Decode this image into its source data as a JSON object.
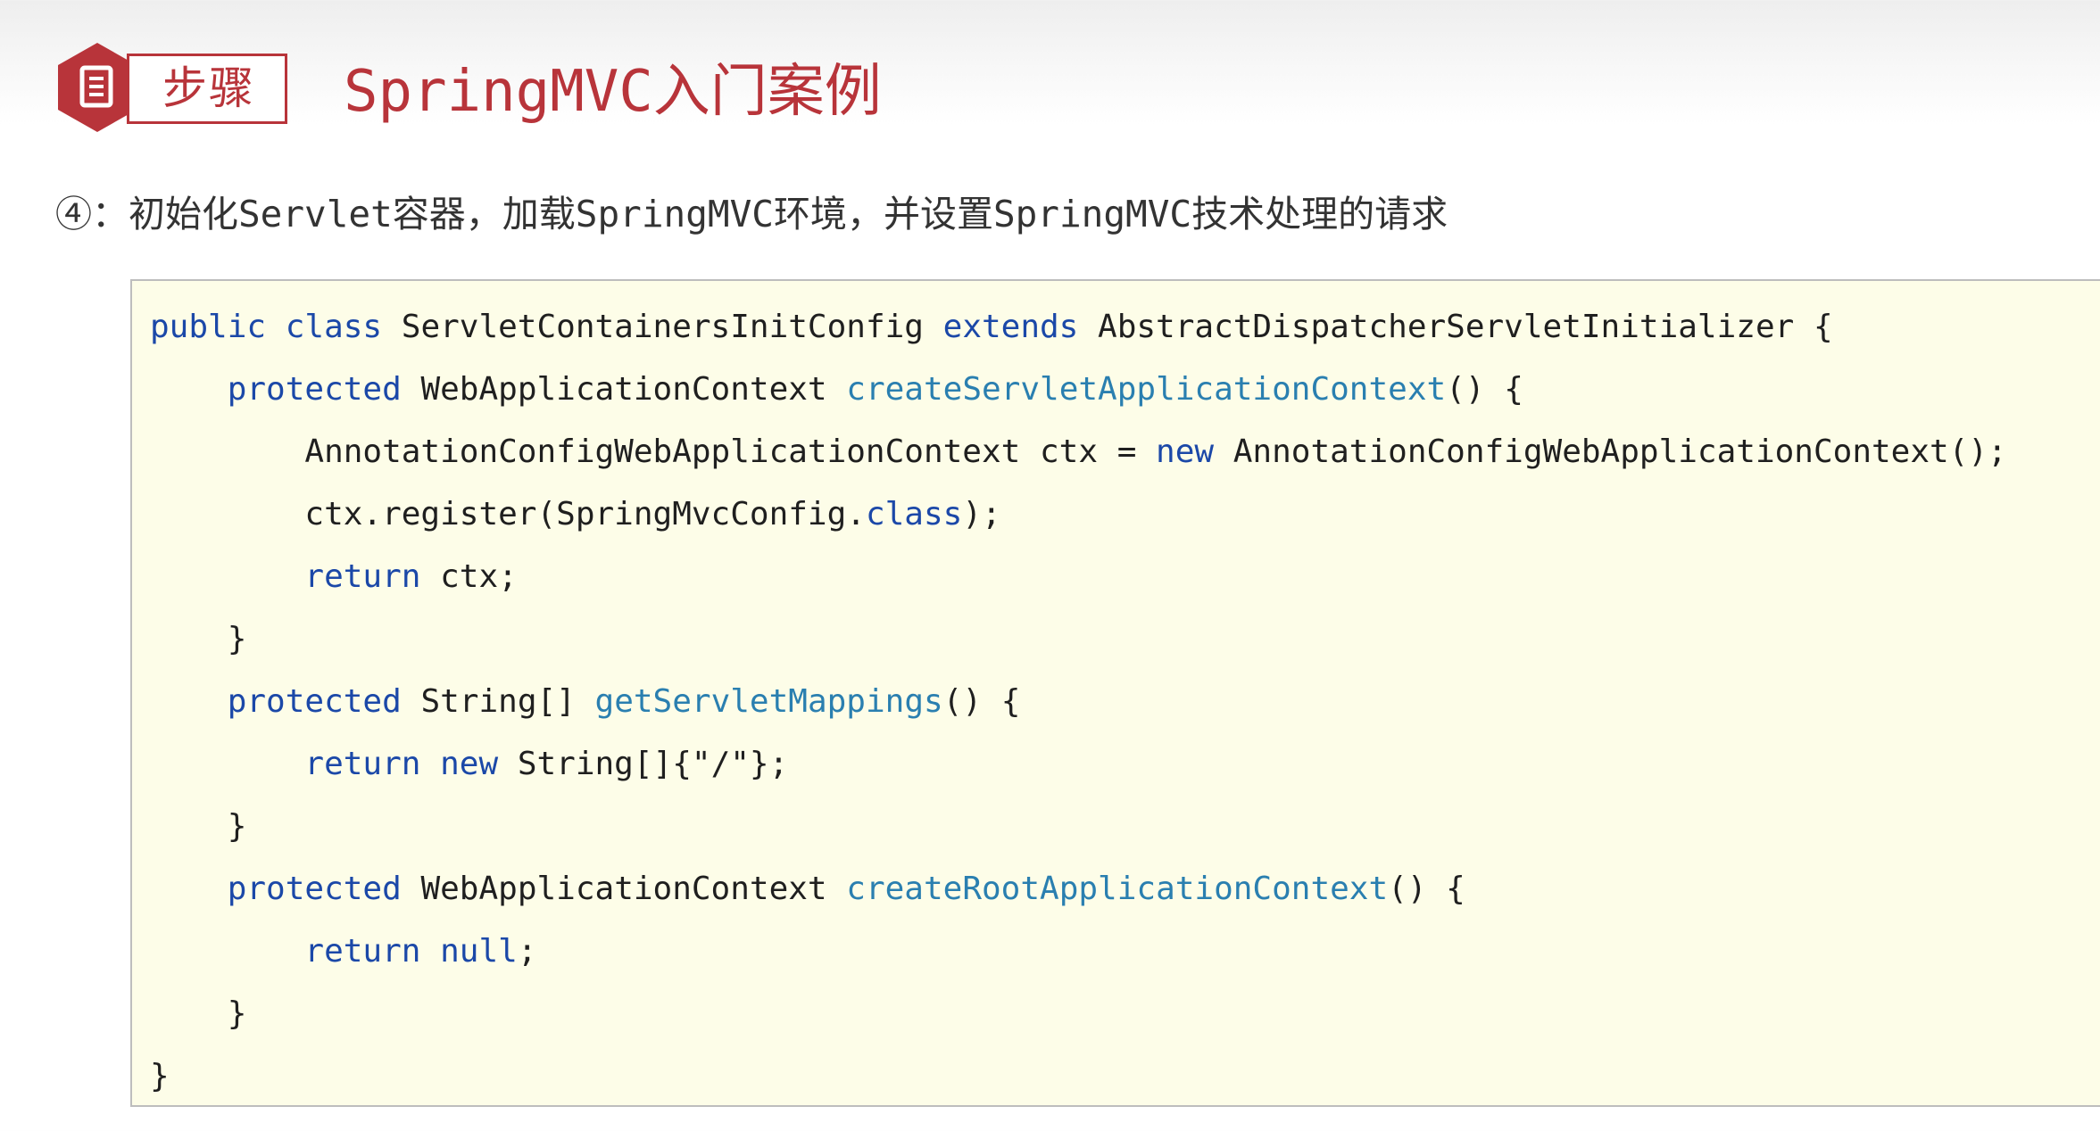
{
  "header": {
    "badge_label": "步骤",
    "title": "SpringMVC入门案例"
  },
  "step": {
    "text": "④：初始化Servlet容器，加载SpringMVC环境，并设置SpringMVC技术处理的请求"
  },
  "code": {
    "lines": [
      [
        {
          "t": "public class ",
          "k": "kw"
        },
        {
          "t": "ServletContainersInitConfig ",
          "k": "pl"
        },
        {
          "t": "extends ",
          "k": "kw"
        },
        {
          "t": "AbstractDispatcherServletInitializer {",
          "k": "pl"
        }
      ],
      [
        {
          "t": "    ",
          "k": "pl"
        },
        {
          "t": "protected ",
          "k": "kw"
        },
        {
          "t": "WebApplicationContext ",
          "k": "pl"
        },
        {
          "t": "createServletApplicationContext",
          "k": "fn"
        },
        {
          "t": "() {",
          "k": "pl"
        }
      ],
      [
        {
          "t": "        AnnotationConfigWebApplicationContext ctx = ",
          "k": "pl"
        },
        {
          "t": "new ",
          "k": "kw"
        },
        {
          "t": "AnnotationConfigWebApplicationContext();",
          "k": "pl"
        }
      ],
      [
        {
          "t": "        ctx.register(SpringMvcConfig.",
          "k": "pl"
        },
        {
          "t": "class",
          "k": "kw"
        },
        {
          "t": ");",
          "k": "pl"
        }
      ],
      [
        {
          "t": "        ",
          "k": "pl"
        },
        {
          "t": "return ",
          "k": "kw"
        },
        {
          "t": "ctx;",
          "k": "pl"
        }
      ],
      [
        {
          "t": "    }",
          "k": "pl"
        }
      ],
      [
        {
          "t": "    ",
          "k": "pl"
        },
        {
          "t": "protected ",
          "k": "kw"
        },
        {
          "t": "String[] ",
          "k": "pl"
        },
        {
          "t": "getServletMappings",
          "k": "fn"
        },
        {
          "t": "() {",
          "k": "pl"
        }
      ],
      [
        {
          "t": "        ",
          "k": "pl"
        },
        {
          "t": "return ",
          "k": "kw"
        },
        {
          "t": "new ",
          "k": "kw"
        },
        {
          "t": "String[]{",
          "k": "pl"
        },
        {
          "t": "\"/\"",
          "k": "str"
        },
        {
          "t": "};",
          "k": "pl"
        }
      ],
      [
        {
          "t": "    }",
          "k": "pl"
        }
      ],
      [
        {
          "t": "    ",
          "k": "pl"
        },
        {
          "t": "protected ",
          "k": "kw"
        },
        {
          "t": "WebApplicationContext ",
          "k": "pl"
        },
        {
          "t": "createRootApplicationContext",
          "k": "fn"
        },
        {
          "t": "() {",
          "k": "pl"
        }
      ],
      [
        {
          "t": "        ",
          "k": "pl"
        },
        {
          "t": "return ",
          "k": "kw"
        },
        {
          "t": "null",
          "k": "kw"
        },
        {
          "t": ";",
          "k": "pl"
        }
      ],
      [
        {
          "t": "    }",
          "k": "pl"
        }
      ],
      [
        {
          "t": "}",
          "k": "pl"
        }
      ]
    ]
  },
  "colors": {
    "accent": "#b8343a",
    "keyword": "#1b48a8",
    "method": "#2a7fb0",
    "code_background": "#fdfde8"
  },
  "icons": {
    "badge": "document-icon"
  }
}
